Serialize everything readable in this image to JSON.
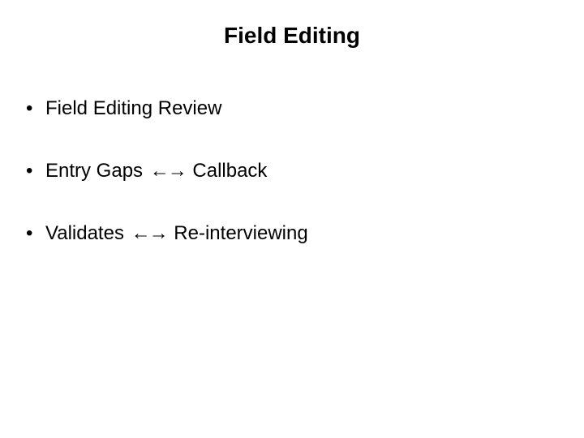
{
  "slide": {
    "title": "Field Editing",
    "bullets": [
      {
        "left": "Field Editing Review",
        "arrows": "",
        "right": ""
      },
      {
        "left": "Entry Gaps",
        "arrows": "←→",
        "right": "Callback"
      },
      {
        "left": "Validates",
        "arrows": "←→",
        "right": "Re-interviewing"
      }
    ]
  }
}
